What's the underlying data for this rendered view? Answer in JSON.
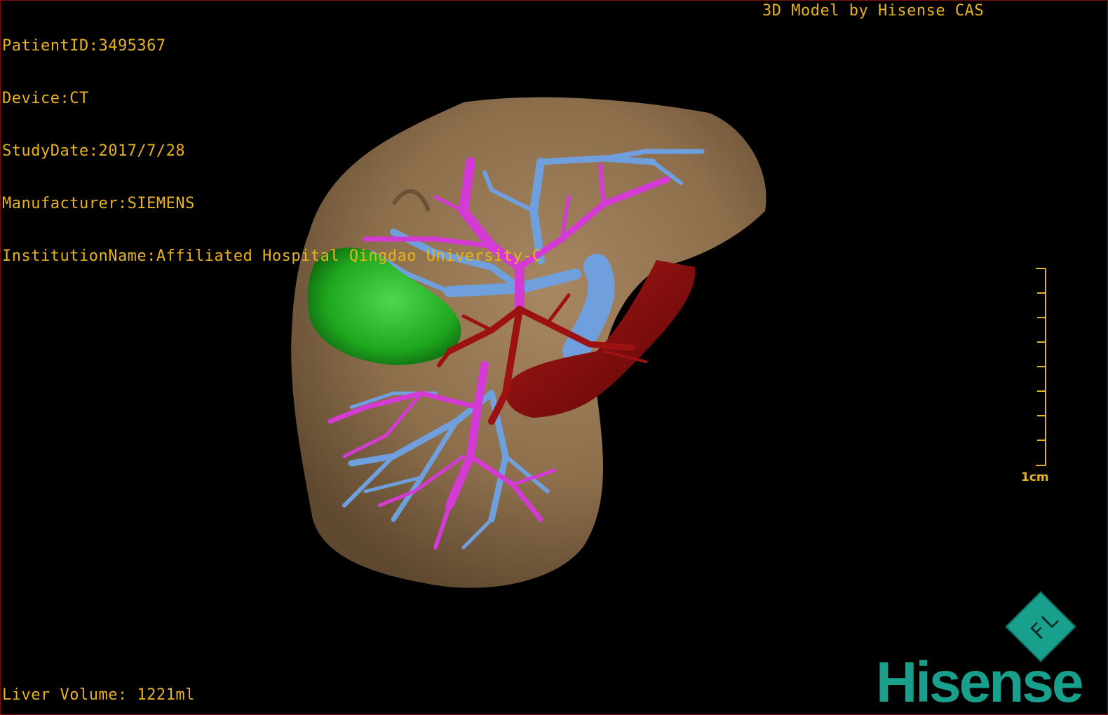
{
  "patient_info": {
    "patient_id": "PatientID:3495367",
    "device": "Device:CT",
    "study_date": "StudyDate:2017/7/28",
    "manufacturer": "Manufacturer:SIEMENS",
    "institution": "InstitutionName:Affiliated Hospital Qingdao University-C"
  },
  "title": "3D Model by Hisense CAS",
  "liver_volume": "Liver Volume: 1221ml",
  "scale_bar": {
    "label": "1cm",
    "ticks": 8
  },
  "orientation_cube": {
    "labels": "F L",
    "icon": "orientation-cube-icon"
  },
  "logo": {
    "text": "Hisense",
    "color": "#18a08c"
  },
  "colors": {
    "text": "#e8b31c",
    "liver": "#8c6e4b",
    "portal_vein": "#6f9fdc",
    "hepatic_artery_branches": "#d43ad4",
    "gallbladder": "#1fa81f",
    "vena_cava": "#8a0d0d",
    "background": "#000000"
  }
}
